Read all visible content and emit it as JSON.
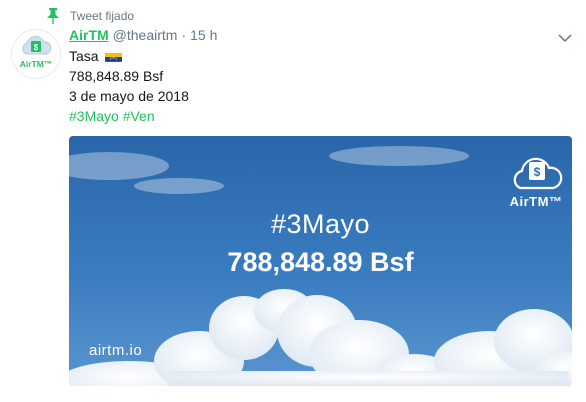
{
  "pinned": {
    "label": "Tweet fijado",
    "icon": "pin-icon"
  },
  "author": {
    "display_name": "AirTM",
    "handle": "@theairtm",
    "separator": "·",
    "time": "15 h",
    "avatar_text": "AirTM™",
    "avatar_badge": "$",
    "brand_color": "#21c15f"
  },
  "tweet": {
    "line1": "Tasa",
    "line1_flag": "venezuela-flag-icon",
    "line2": "788,848.89 Bsf",
    "line3": "3 de mayo de 2018",
    "hashtag1": "#3Mayo",
    "hashtag2": "#Ven"
  },
  "media": {
    "hashtag": "#3Mayo",
    "amount": "788,848.89 Bsf",
    "url": "airtm.io",
    "logo_text": "AirTM™",
    "logo_badge": "$",
    "sky_color": "#2f6fb3"
  }
}
